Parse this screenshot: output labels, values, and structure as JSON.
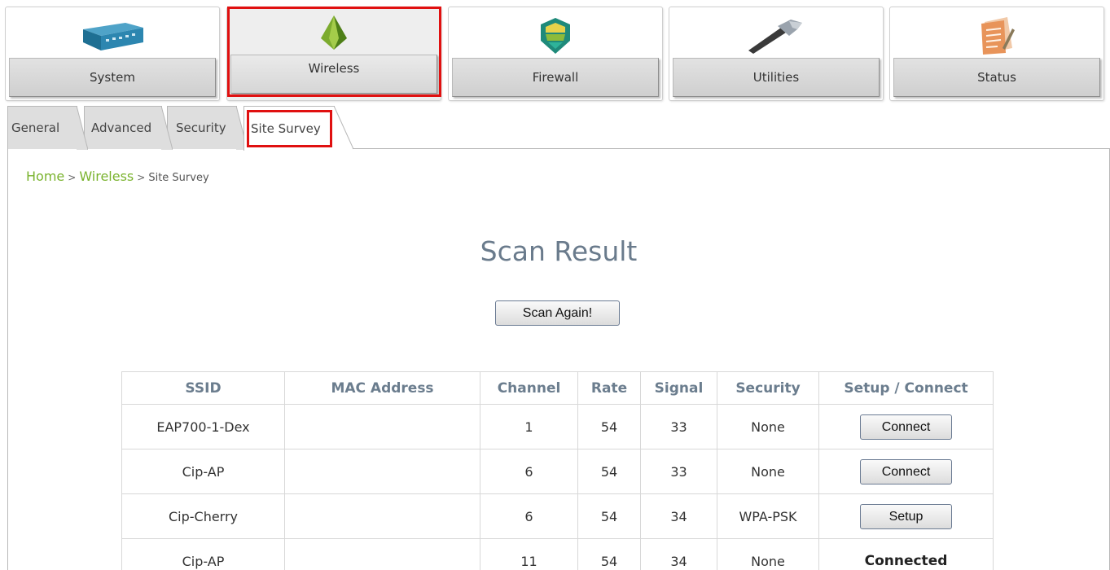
{
  "nav": {
    "items": [
      {
        "label": "System",
        "icon": "network-device-icon"
      },
      {
        "label": "Wireless",
        "icon": "wireless-antenna-icon"
      },
      {
        "label": "Firewall",
        "icon": "firewall-shield-icon"
      },
      {
        "label": "Utilities",
        "icon": "hammer-icon"
      },
      {
        "label": "Status",
        "icon": "notepad-icon"
      }
    ],
    "active": "Wireless"
  },
  "tabs": {
    "items": [
      {
        "label": "General"
      },
      {
        "label": "Advanced"
      },
      {
        "label": "Security"
      },
      {
        "label": "Site Survey"
      }
    ],
    "active": "Site Survey"
  },
  "breadcrumb": {
    "home": "Home",
    "section": "Wireless",
    "current": "Site Survey",
    "separator": ">"
  },
  "page": {
    "title": "Scan Result",
    "scan_button": "Scan Again!"
  },
  "table": {
    "headers": [
      "SSID",
      "MAC Address",
      "Channel",
      "Rate",
      "Signal",
      "Security",
      "Setup / Connect"
    ],
    "rows": [
      {
        "ssid": "EAP700-1-Dex",
        "mac": "",
        "channel": "1",
        "rate": "54",
        "signal": "33",
        "security": "None",
        "action": "Connect"
      },
      {
        "ssid": "Cip-AP",
        "mac": "",
        "channel": "6",
        "rate": "54",
        "signal": "33",
        "security": "None",
        "action": "Connect"
      },
      {
        "ssid": "Cip-Cherry",
        "mac": "",
        "channel": "6",
        "rate": "54",
        "signal": "34",
        "security": "WPA-PSK",
        "action": "Setup"
      },
      {
        "ssid": "Cip-AP",
        "mac": "",
        "channel": "11",
        "rate": "54",
        "signal": "34",
        "security": "None",
        "status": "Connected"
      }
    ]
  },
  "colors": {
    "highlight": "#e01010",
    "breadcrumb_link": "#7ab32e",
    "title": "#6a7b8c",
    "table_header": "#6b7d8e"
  }
}
